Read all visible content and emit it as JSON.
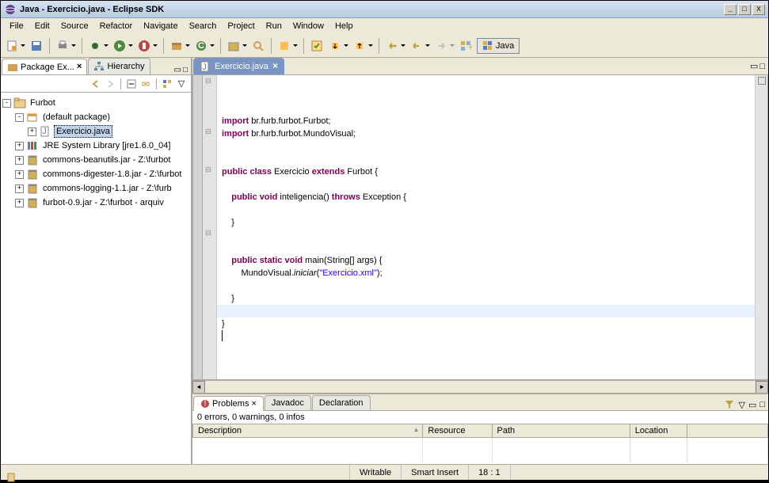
{
  "window": {
    "title": "Java - Exercicio.java - Eclipse SDK"
  },
  "menu": [
    "File",
    "Edit",
    "Source",
    "Refactor",
    "Navigate",
    "Search",
    "Project",
    "Run",
    "Window",
    "Help"
  ],
  "perspective": {
    "label": "Java"
  },
  "left": {
    "tabs": [
      {
        "label": "Package Ex...",
        "active": true,
        "closable": true
      },
      {
        "label": "Hierarchy",
        "active": false
      }
    ],
    "tree": {
      "root": "Furbot",
      "default_pkg": "(default package)",
      "file": "Exercicio.java",
      "jre": "JRE System Library [jre1.6.0_04]",
      "jars": [
        "commons-beanutils.jar - Z:\\furbot",
        "commons-digester-1.8.jar - Z:\\furbot",
        "commons-logging-1.1.jar - Z:\\furb",
        "furbot-0.9.jar - Z:\\furbot - arquiv"
      ]
    }
  },
  "editor": {
    "tab_label": "Exercicio.java",
    "code": {
      "import_kw": "import",
      "import1": " br.furb.furbot.Furbot;",
      "import2": " br.furb.furbot.MundoVisual;",
      "public_kw": "public",
      "class_kw": "class",
      "cls": " Exercicio ",
      "extends_kw": "extends",
      "ext": " Furbot {",
      "void_kw": "void",
      "method1": " inteligencia() ",
      "throws_kw": "throws",
      "throws_rest": " Exception {",
      "brace": "}",
      "static_kw": "static",
      "main_sig": " main(String[] args) {",
      "invoke_cls": "MundoVisual.",
      "invoke_m": "iniciar",
      "invoke_arg": "(\"Exercicio.xml\");",
      "string_val": "\"Exercicio.xml\""
    }
  },
  "problems": {
    "tabs": [
      "Problems",
      "Javadoc",
      "Declaration"
    ],
    "summary": "0 errors, 0 warnings, 0 infos",
    "columns": [
      "Description",
      "Resource",
      "Path",
      "Location"
    ]
  },
  "status": {
    "writable": "Writable",
    "insert": "Smart Insert",
    "pos": "18 : 1"
  }
}
